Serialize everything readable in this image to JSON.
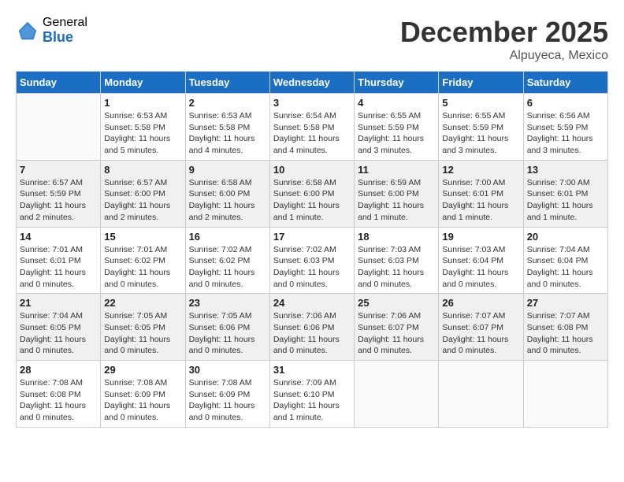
{
  "header": {
    "logo_general": "General",
    "logo_blue": "Blue",
    "month_title": "December 2025",
    "location": "Alpuyeca, Mexico"
  },
  "days_of_week": [
    "Sunday",
    "Monday",
    "Tuesday",
    "Wednesday",
    "Thursday",
    "Friday",
    "Saturday"
  ],
  "weeks": [
    [
      {
        "day": "",
        "info": ""
      },
      {
        "day": "1",
        "info": "Sunrise: 6:53 AM\nSunset: 5:58 PM\nDaylight: 11 hours\nand 5 minutes."
      },
      {
        "day": "2",
        "info": "Sunrise: 6:53 AM\nSunset: 5:58 PM\nDaylight: 11 hours\nand 4 minutes."
      },
      {
        "day": "3",
        "info": "Sunrise: 6:54 AM\nSunset: 5:58 PM\nDaylight: 11 hours\nand 4 minutes."
      },
      {
        "day": "4",
        "info": "Sunrise: 6:55 AM\nSunset: 5:59 PM\nDaylight: 11 hours\nand 3 minutes."
      },
      {
        "day": "5",
        "info": "Sunrise: 6:55 AM\nSunset: 5:59 PM\nDaylight: 11 hours\nand 3 minutes."
      },
      {
        "day": "6",
        "info": "Sunrise: 6:56 AM\nSunset: 5:59 PM\nDaylight: 11 hours\nand 3 minutes."
      }
    ],
    [
      {
        "day": "7",
        "info": "Sunrise: 6:57 AM\nSunset: 5:59 PM\nDaylight: 11 hours\nand 2 minutes."
      },
      {
        "day": "8",
        "info": "Sunrise: 6:57 AM\nSunset: 6:00 PM\nDaylight: 11 hours\nand 2 minutes."
      },
      {
        "day": "9",
        "info": "Sunrise: 6:58 AM\nSunset: 6:00 PM\nDaylight: 11 hours\nand 2 minutes."
      },
      {
        "day": "10",
        "info": "Sunrise: 6:58 AM\nSunset: 6:00 PM\nDaylight: 11 hours\nand 1 minute."
      },
      {
        "day": "11",
        "info": "Sunrise: 6:59 AM\nSunset: 6:00 PM\nDaylight: 11 hours\nand 1 minute."
      },
      {
        "day": "12",
        "info": "Sunrise: 7:00 AM\nSunset: 6:01 PM\nDaylight: 11 hours\nand 1 minute."
      },
      {
        "day": "13",
        "info": "Sunrise: 7:00 AM\nSunset: 6:01 PM\nDaylight: 11 hours\nand 1 minute."
      }
    ],
    [
      {
        "day": "14",
        "info": "Sunrise: 7:01 AM\nSunset: 6:01 PM\nDaylight: 11 hours\nand 0 minutes."
      },
      {
        "day": "15",
        "info": "Sunrise: 7:01 AM\nSunset: 6:02 PM\nDaylight: 11 hours\nand 0 minutes."
      },
      {
        "day": "16",
        "info": "Sunrise: 7:02 AM\nSunset: 6:02 PM\nDaylight: 11 hours\nand 0 minutes."
      },
      {
        "day": "17",
        "info": "Sunrise: 7:02 AM\nSunset: 6:03 PM\nDaylight: 11 hours\nand 0 minutes."
      },
      {
        "day": "18",
        "info": "Sunrise: 7:03 AM\nSunset: 6:03 PM\nDaylight: 11 hours\nand 0 minutes."
      },
      {
        "day": "19",
        "info": "Sunrise: 7:03 AM\nSunset: 6:04 PM\nDaylight: 11 hours\nand 0 minutes."
      },
      {
        "day": "20",
        "info": "Sunrise: 7:04 AM\nSunset: 6:04 PM\nDaylight: 11 hours\nand 0 minutes."
      }
    ],
    [
      {
        "day": "21",
        "info": "Sunrise: 7:04 AM\nSunset: 6:05 PM\nDaylight: 11 hours\nand 0 minutes."
      },
      {
        "day": "22",
        "info": "Sunrise: 7:05 AM\nSunset: 6:05 PM\nDaylight: 11 hours\nand 0 minutes."
      },
      {
        "day": "23",
        "info": "Sunrise: 7:05 AM\nSunset: 6:06 PM\nDaylight: 11 hours\nand 0 minutes."
      },
      {
        "day": "24",
        "info": "Sunrise: 7:06 AM\nSunset: 6:06 PM\nDaylight: 11 hours\nand 0 minutes."
      },
      {
        "day": "25",
        "info": "Sunrise: 7:06 AM\nSunset: 6:07 PM\nDaylight: 11 hours\nand 0 minutes."
      },
      {
        "day": "26",
        "info": "Sunrise: 7:07 AM\nSunset: 6:07 PM\nDaylight: 11 hours\nand 0 minutes."
      },
      {
        "day": "27",
        "info": "Sunrise: 7:07 AM\nSunset: 6:08 PM\nDaylight: 11 hours\nand 0 minutes."
      }
    ],
    [
      {
        "day": "28",
        "info": "Sunrise: 7:08 AM\nSunset: 6:08 PM\nDaylight: 11 hours\nand 0 minutes."
      },
      {
        "day": "29",
        "info": "Sunrise: 7:08 AM\nSunset: 6:09 PM\nDaylight: 11 hours\nand 0 minutes."
      },
      {
        "day": "30",
        "info": "Sunrise: 7:08 AM\nSunset: 6:09 PM\nDaylight: 11 hours\nand 0 minutes."
      },
      {
        "day": "31",
        "info": "Sunrise: 7:09 AM\nSunset: 6:10 PM\nDaylight: 11 hours\nand 1 minute."
      },
      {
        "day": "",
        "info": ""
      },
      {
        "day": "",
        "info": ""
      },
      {
        "day": "",
        "info": ""
      }
    ]
  ]
}
